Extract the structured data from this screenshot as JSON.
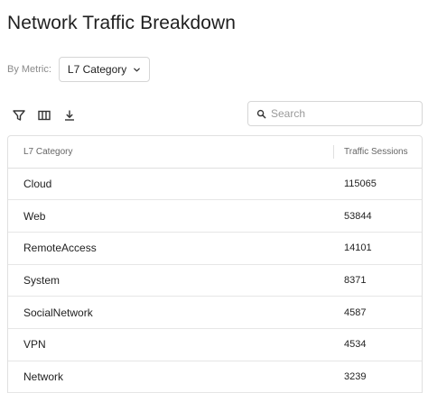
{
  "page": {
    "title": "Network Traffic Breakdown"
  },
  "metric": {
    "label": "By Metric:",
    "selected": "L7 Category"
  },
  "toolbar": {
    "icons": [
      "filter-icon",
      "columns-icon",
      "download-icon"
    ]
  },
  "search": {
    "placeholder": "Search",
    "value": ""
  },
  "table": {
    "columns": [
      "L7 Category",
      "Traffic Sessions"
    ],
    "rows": [
      {
        "category": "Cloud",
        "sessions": "115065"
      },
      {
        "category": "Web",
        "sessions": "53844"
      },
      {
        "category": "RemoteAccess",
        "sessions": "14101"
      },
      {
        "category": "System",
        "sessions": "8371"
      },
      {
        "category": "SocialNetwork",
        "sessions": "4587"
      },
      {
        "category": "VPN",
        "sessions": "4534"
      },
      {
        "category": "Network",
        "sessions": "3239"
      }
    ]
  },
  "colors": {
    "text": "#222222",
    "muted": "#8a8a8a",
    "border": "#e0e0e0"
  }
}
